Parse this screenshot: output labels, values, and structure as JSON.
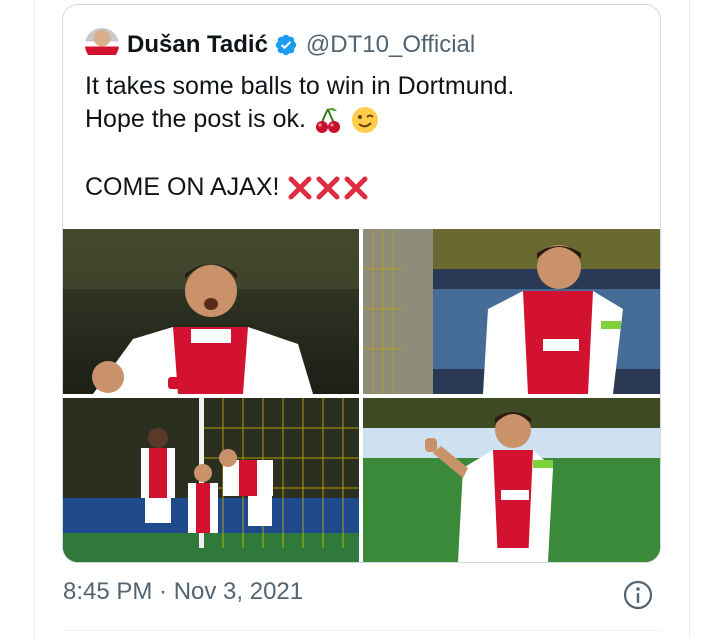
{
  "author": {
    "display_name": "Dušan Tadić",
    "handle": "@DT10_Official",
    "verified": true,
    "avatar_icon": "profile-avatar"
  },
  "tweet": {
    "line1": "It takes some balls to win in Dortmund.",
    "line2": "Hope the post is ok.",
    "line2_emojis": [
      "cherries-emoji",
      "winking-face-emoji"
    ],
    "line3": "COME ON AJAX!",
    "line3_emojis": [
      "cross-mark-emoji",
      "cross-mark-emoji",
      "cross-mark-emoji"
    ]
  },
  "media": {
    "photos": [
      {
        "desc_icon": "photo-player-celebrating"
      },
      {
        "desc_icon": "photo-player-smiling"
      },
      {
        "desc_icon": "photo-team-by-goal"
      },
      {
        "desc_icon": "photo-player-pointing"
      }
    ]
  },
  "meta": {
    "timestamp": "8:45 PM · Nov 3, 2021",
    "info_icon": "info-icon"
  },
  "colors": {
    "verified_blue": "#1d9bf0",
    "ajax_red": "#d2122e",
    "muted_text": "#536471",
    "border": "#cfd9de"
  }
}
